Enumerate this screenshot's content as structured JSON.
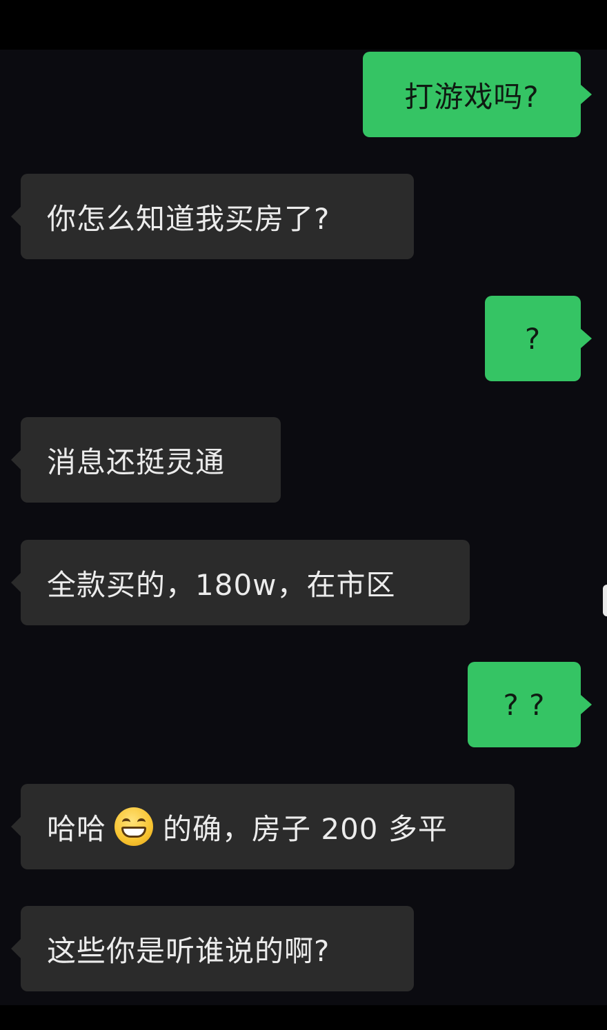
{
  "messages": [
    {
      "side": "out",
      "text": "打游戏吗?"
    },
    {
      "side": "in",
      "text": "你怎么知道我买房了?"
    },
    {
      "side": "out",
      "text": "?"
    },
    {
      "side": "in",
      "text": "消息还挺灵通"
    },
    {
      "side": "in",
      "text": "全款买的，180w，在市区"
    },
    {
      "side": "out",
      "text": "? ?"
    },
    {
      "side": "in",
      "text_before": "哈哈",
      "emoji": "grinning-face",
      "text_after": "的确，房子 200 多平"
    },
    {
      "side": "in",
      "text": "这些你是听谁说的啊?"
    }
  ],
  "colors": {
    "outgoing_bubble": "#35c464",
    "incoming_bubble": "#2b2b2b",
    "background": "#0b0b10"
  }
}
